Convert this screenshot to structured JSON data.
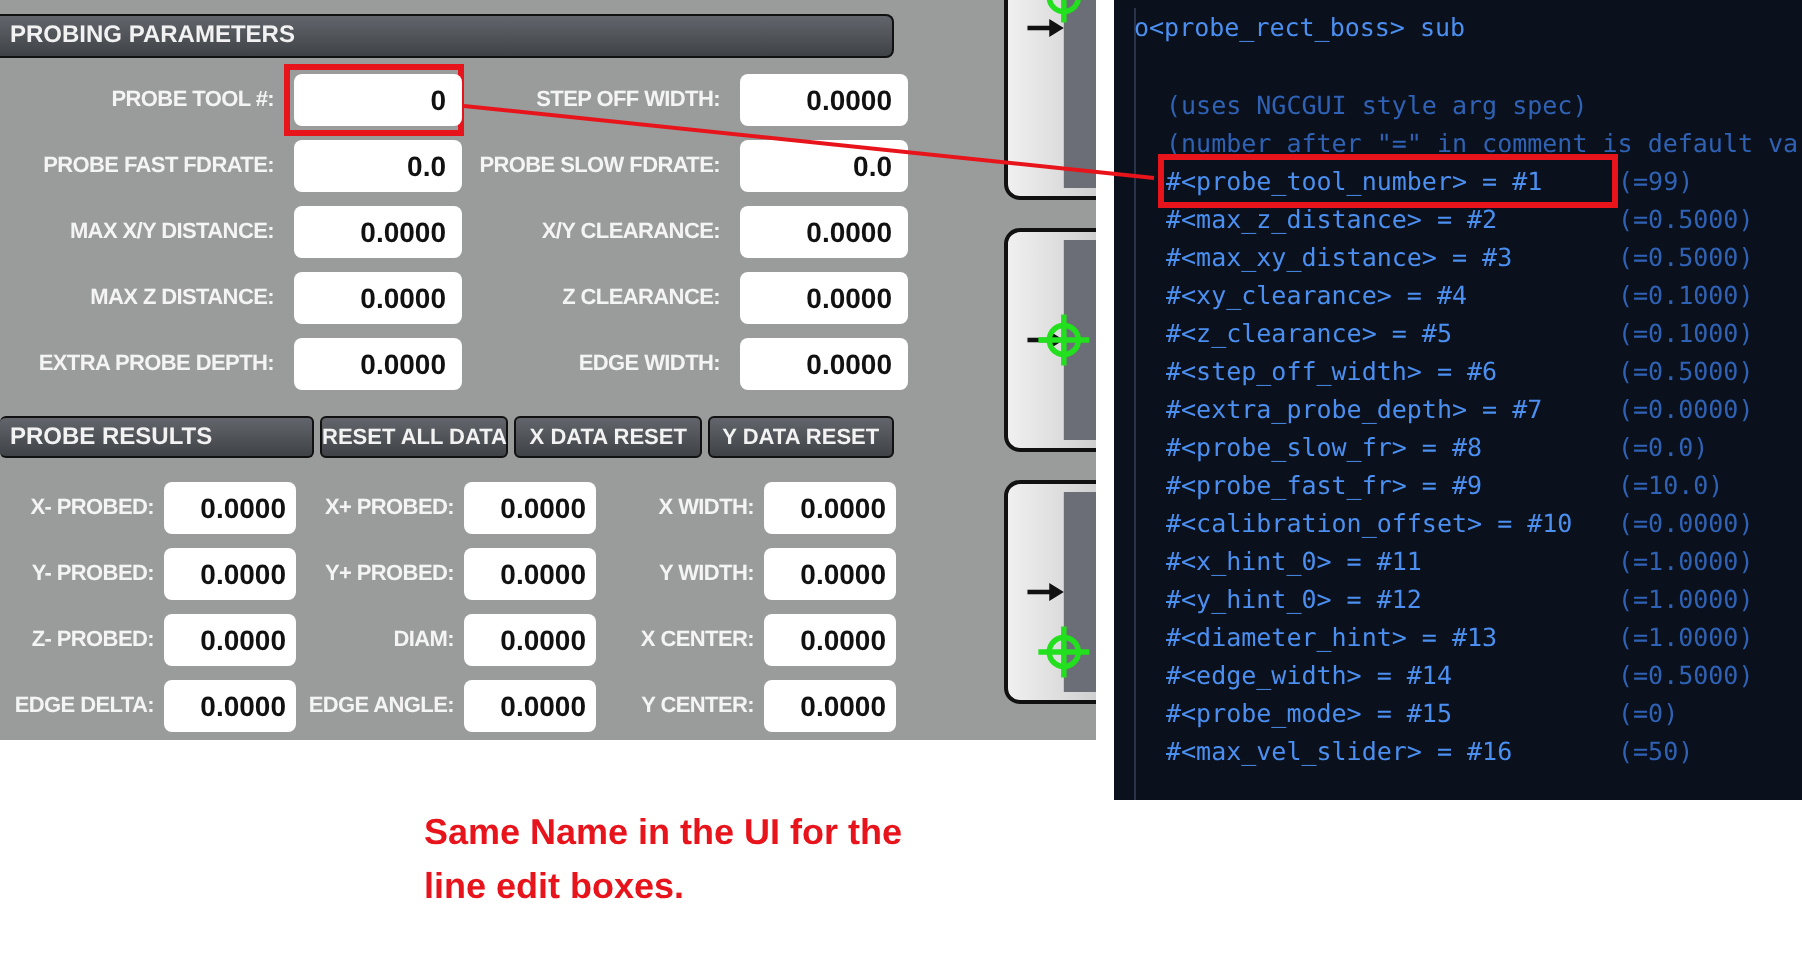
{
  "probing_parameters": {
    "title": "PROBING PARAMETERS",
    "fields": [
      {
        "label": "PROBE TOOL #:",
        "value": "0",
        "highlighted": true
      },
      {
        "label": "STEP OFF WIDTH:",
        "value": "0.0000",
        "highlighted": false
      },
      {
        "label": "PROBE FAST FDRATE:",
        "value": "0.0",
        "highlighted": false
      },
      {
        "label": "PROBE SLOW FDRATE:",
        "value": "0.0",
        "highlighted": false
      },
      {
        "label": "MAX X/Y DISTANCE:",
        "value": "0.0000",
        "highlighted": false
      },
      {
        "label": "X/Y CLEARANCE:",
        "value": "0.0000",
        "highlighted": false
      },
      {
        "label": "MAX Z DISTANCE:",
        "value": "0.0000",
        "highlighted": false
      },
      {
        "label": "Z CLEARANCE:",
        "value": "0.0000",
        "highlighted": false
      },
      {
        "label": "EXTRA PROBE DEPTH:",
        "value": "0.0000",
        "highlighted": false
      },
      {
        "label": "EDGE WIDTH:",
        "value": "0.0000",
        "highlighted": false
      }
    ]
  },
  "probe_results": {
    "title": "PROBE RESULTS",
    "buttons": [
      "RESET ALL DATA",
      "X DATA RESET",
      "Y DATA RESET"
    ],
    "fields": [
      {
        "label": "X- PROBED:",
        "value": "0.0000"
      },
      {
        "label": "X+ PROBED:",
        "value": "0.0000"
      },
      {
        "label": "X WIDTH:",
        "value": "0.0000"
      },
      {
        "label": "Y- PROBED:",
        "value": "0.0000"
      },
      {
        "label": "Y+ PROBED:",
        "value": "0.0000"
      },
      {
        "label": "Y WIDTH:",
        "value": "0.0000"
      },
      {
        "label": "Z- PROBED:",
        "value": "0.0000"
      },
      {
        "label": "DIAM:",
        "value": "0.0000"
      },
      {
        "label": "X CENTER:",
        "value": "0.0000"
      },
      {
        "label": "EDGE DELTA:",
        "value": "0.0000"
      },
      {
        "label": "EDGE ANGLE:",
        "value": "0.0000"
      },
      {
        "label": "Y CENTER:",
        "value": "0.0000"
      }
    ]
  },
  "side_buttons": [
    {
      "kind": "arrow-top"
    },
    {
      "kind": "arrow-mid"
    },
    {
      "kind": "arrow-low"
    }
  ],
  "code_editor": {
    "lines": [
      {
        "kind": "header",
        "text": "o<probe_rect_boss> sub"
      },
      {
        "kind": "blank"
      },
      {
        "kind": "comment",
        "text": "(uses NGCGUI style arg spec)"
      },
      {
        "kind": "comment",
        "text": "(number after \"=\" in comment is default va"
      },
      {
        "kind": "param",
        "code": "#<probe_tool_number> = #1",
        "comment": "(=99)",
        "highlighted": true
      },
      {
        "kind": "param",
        "code": "#<max_z_distance> = #2",
        "comment": "(=0.5000)",
        "highlighted": false
      },
      {
        "kind": "param",
        "code": "#<max_xy_distance> = #3",
        "comment": "(=0.5000)",
        "highlighted": false
      },
      {
        "kind": "param",
        "code": "#<xy_clearance> = #4",
        "comment": "(=0.1000)",
        "highlighted": false
      },
      {
        "kind": "param",
        "code": "#<z_clearance> = #5",
        "comment": "(=0.1000)",
        "highlighted": false
      },
      {
        "kind": "param",
        "code": "#<step_off_width> = #6",
        "comment": "(=0.5000)",
        "highlighted": false
      },
      {
        "kind": "param",
        "code": "#<extra_probe_depth> = #7",
        "comment": "(=0.0000)",
        "highlighted": false
      },
      {
        "kind": "param",
        "code": "#<probe_slow_fr> = #8",
        "comment": "(=0.0)",
        "highlighted": false
      },
      {
        "kind": "param",
        "code": "#<probe_fast_fr> = #9",
        "comment": "(=10.0)",
        "highlighted": false
      },
      {
        "kind": "param",
        "code": "#<calibration_offset> = #10",
        "comment": "(=0.0000)",
        "highlighted": false
      },
      {
        "kind": "param",
        "code": "#<x_hint_0> = #11",
        "comment": "(=1.0000)",
        "highlighted": false
      },
      {
        "kind": "param",
        "code": "#<y_hint_0> = #12",
        "comment": "(=1.0000)",
        "highlighted": false
      },
      {
        "kind": "param",
        "code": "#<diameter_hint> = #13",
        "comment": "(=1.0000)",
        "highlighted": false
      },
      {
        "kind": "param",
        "code": "#<edge_width> = #14",
        "comment": "(=0.5000)",
        "highlighted": false
      },
      {
        "kind": "param",
        "code": "#<probe_mode> = #15",
        "comment": "(=0)",
        "highlighted": false
      },
      {
        "kind": "param",
        "code": "#<max_vel_slider> = #16",
        "comment": "(=50)",
        "highlighted": false
      }
    ]
  },
  "annotation": {
    "text": "Same Name in the UI for the line edit boxes."
  }
}
